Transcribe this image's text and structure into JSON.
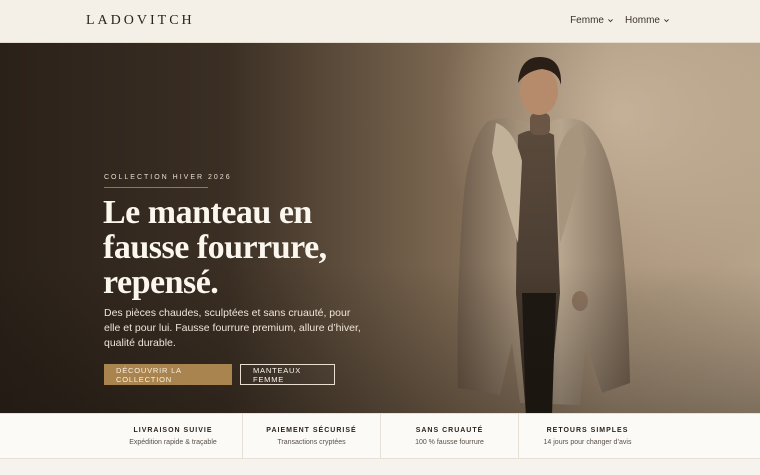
{
  "brand": {
    "logo": "LADOVITCH"
  },
  "nav": {
    "items": [
      {
        "label": "Femme",
        "icon": "chevron-down-icon"
      },
      {
        "label": "Homme",
        "icon": "chevron-down-icon"
      }
    ]
  },
  "hero": {
    "eyebrow": "COLLECTION HIVER 2026",
    "headline": [
      "Le manteau en",
      "fausse fourrure,",
      "repensé."
    ],
    "lead": "Des pièces chaudes, sculptées et sans cruauté, pour elle et pour lui. Fausse fourrure premium, allure d’hiver, qualité durable.",
    "cta_primary": "DÉCOUVRIR LA COLLECTION",
    "cta_secondary": "MANTEAUX FEMME"
  },
  "features": [
    {
      "title": "LIVRAISON SUIVIE",
      "subtitle": "Expédition rapide & traçable"
    },
    {
      "title": "PAIEMENT SÉCURISÉ",
      "subtitle": "Transactions cryptées"
    },
    {
      "title": "SANS CRUAUTÉ",
      "subtitle": "100 % fausse fourrure"
    },
    {
      "title": "RETOURS SIMPLES",
      "subtitle": "14 jours pour changer d’avis"
    }
  ],
  "colors": {
    "accent": "#a9844f",
    "header_bg": "#f5f0e7",
    "hero_dark": "#2a2119",
    "text_light": "#fbf7ef"
  }
}
